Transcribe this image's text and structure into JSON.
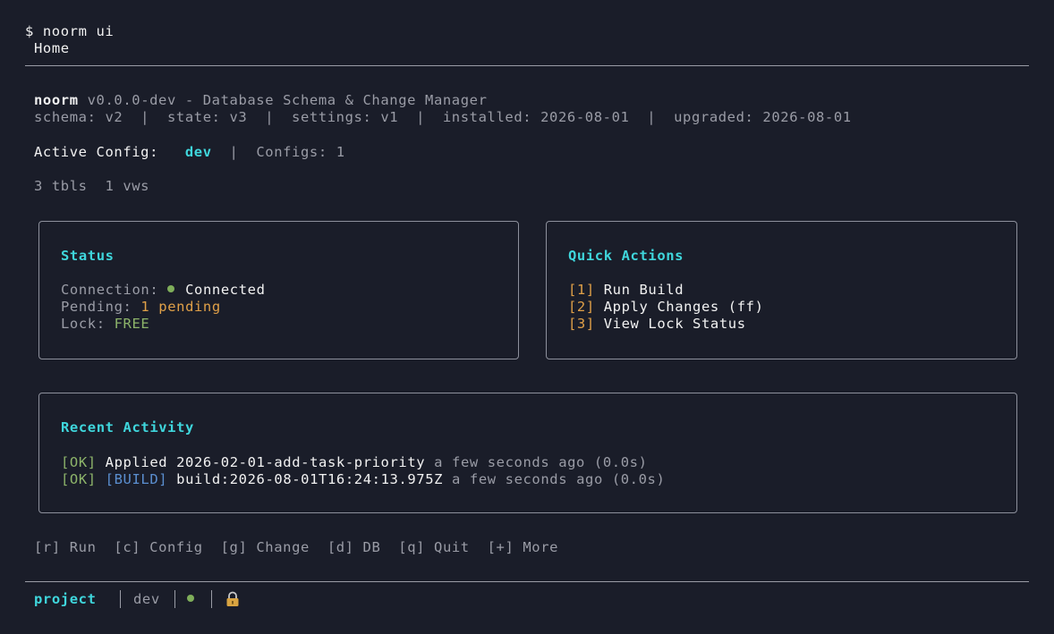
{
  "prompt": "$ noorm ui",
  "breadcrumb": "Home",
  "header": {
    "app_name": "noorm",
    "version_line": " v0.0.0-dev - Database Schema & Change Manager",
    "meta_line": "schema: v2  |  state: v3  |  settings: v1  |  installed: 2026-08-01  |  upgraded: 2026-08-01"
  },
  "config": {
    "label": "Active Config:",
    "active": "dev",
    "separator": "|",
    "count": "Configs: 1"
  },
  "db_counts": "3 tbls  1 vws",
  "status_panel": {
    "title": "Status",
    "connection_label": "Connection:",
    "connection_value": "Connected",
    "pending_label": "Pending:",
    "pending_value": "1 pending",
    "lock_label": "Lock:",
    "lock_value": "FREE"
  },
  "quick_actions": {
    "title": "Quick Actions",
    "items": [
      {
        "key": "[1]",
        "label": "Run Build"
      },
      {
        "key": "[2]",
        "label": "Apply Changes (ff)"
      },
      {
        "key": "[3]",
        "label": "View Lock Status"
      }
    ]
  },
  "activity": {
    "title": "Recent Activity",
    "rows": [
      {
        "status": "[OK]",
        "tag": "",
        "text": "Applied 2026-02-01-add-task-priority",
        "time": " a few seconds ago (0.0s)"
      },
      {
        "status": "[OK]",
        "tag": "[BUILD]",
        "text": "build:2026-08-01T16:24:13.975Z",
        "time": " a few seconds ago (0.0s)"
      }
    ]
  },
  "shortcuts": [
    "[r] Run",
    "[c] Config",
    "[g] Change",
    "[d] DB",
    "[q] Quit",
    "[+] More"
  ],
  "statusbar": {
    "project": "project",
    "config": "dev",
    "icons": [
      "status-dot-icon",
      "lock-icon"
    ]
  },
  "colors": {
    "background": "#1a1d29",
    "accent": "#3fd6dc",
    "warning": "#e0a048",
    "success": "#8db46a",
    "info": "#5b8fd0"
  }
}
